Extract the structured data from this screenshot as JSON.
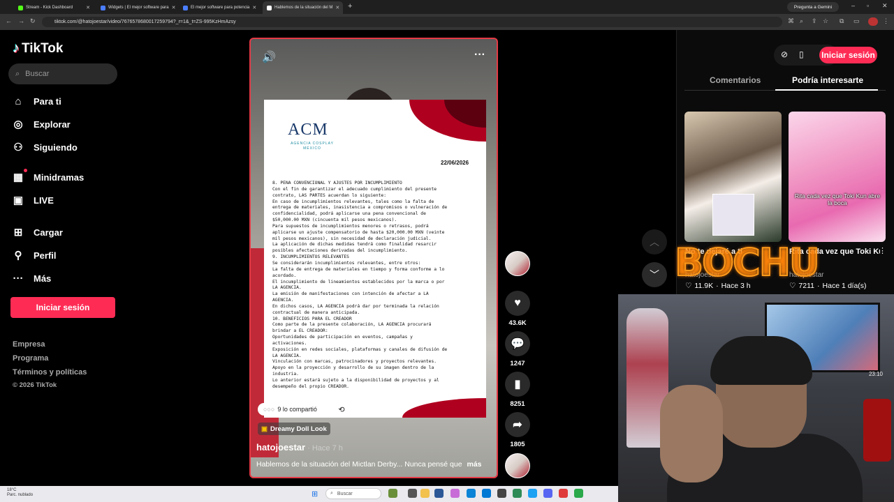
{
  "browser": {
    "tabs": [
      {
        "label": "Stream - Kick Dashboard",
        "color": "#53fc18"
      },
      {
        "label": "Widgets | El mejor software para",
        "color": "#4a7dff"
      },
      {
        "label": "El mejor software para potencia",
        "color": "#4a7dff"
      },
      {
        "label": "Hablemos de la situación del M",
        "color": "#111111"
      }
    ],
    "gemini_label": "Pregunta a Gemini",
    "url": "tiktok.com/@hatojoestar/video/7676578680017259794?_r=1&_t=ZS-995KzHmAzsy"
  },
  "sidebar": {
    "logo": "TikTok",
    "search_placeholder": "Buscar",
    "nav": [
      {
        "label": "Para ti",
        "icon": "home-icon"
      },
      {
        "label": "Explorar",
        "icon": "compass-icon"
      },
      {
        "label": "Siguiendo",
        "icon": "following-icon"
      },
      {
        "label": "Minidramas",
        "icon": "film-icon"
      },
      {
        "label": "LIVE",
        "icon": "live-icon"
      },
      {
        "label": "Cargar",
        "icon": "upload-icon"
      },
      {
        "label": "Perfil",
        "icon": "profile-icon"
      },
      {
        "label": "Más",
        "icon": "more-icon"
      }
    ],
    "login_button": "Iniciar sesión",
    "footer": [
      "Empresa",
      "Programa",
      "Términos y políticas"
    ],
    "copyright": "© 2026 TikTok"
  },
  "video": {
    "document": {
      "logo": "ACM",
      "logo_sub": "AGENCIA COSPLAY MÉXICO",
      "date": "22/06/2026",
      "lines": [
        "8. PENA CONVENCIONAL Y AJUSTES POR INCUMPLIMIENTO",
        "Con el fin de garantizar el adecuado cumplimiento del presente",
        "contrato, LAS PARTES acuerdan lo siguiente:",
        "En caso de incumplimientos relevantes, tales como la falta de",
        "entrega de materiales, inasistencia a compromisos o vulneración de",
        "confidencialidad, podrá aplicarse una pena convencional de",
        "$50,000.00 MXN (cincuenta mil pesos mexicanos).",
        "Para supuestos de incumplimientos menores o retrasos, podrá",
        "aplicarse un ajuste compensatorio de hasta $20,000.00 MXN (veinte",
        "mil pesos mexicanos), sin necesidad de declaración judicial.",
        "La aplicación de dichas medidas tendrá como finalidad resarcir",
        "posibles afectaciones derivadas del incumplimiento.",
        "9. INCUMPLIMIENTOS RELEVANTES",
        "Se considerarán incumplimientos relevantes, entre otros:",
        "La falta de entrega de materiales en tiempo y forma conforme a lo",
        "acordado.",
        "El incumplimiento de lineamientos establecidos por la marca o por",
        "LA AGENCIA.",
        "La emisión de manifestaciones con intención de afectar a LA",
        "AGENCIA.",
        "En dichos casos, LA AGENCIA podrá dar por terminada la relación",
        "contractual de manera anticipada.",
        "10. BENEFICIOS PARA EL CREADOR",
        "Como parte de la presente colaboración, LA AGENCIA procurará",
        "brindar a EL CREADOR:",
        "Oportunidades de participación en eventos, campañas y",
        "activaciones.",
        "Exposición en redes sociales, plataformas y canales de difusión de",
        "LA AGENCIA.",
        "Vinculación con marcas, patrocinadores y proyectos relevantes.",
        "Apoyo en la proyección y desarrollo de su imagen dentro de la",
        "industria.",
        "Lo anterior estará sujeto a la disponibilidad de proyectos y al",
        "desempeño del propio CREADOR."
      ]
    },
    "shared_text": "9 lo compartió",
    "effect_label": "Dreamy Doll Look",
    "author": "hatojoestar",
    "posted": " · Hace 7 h",
    "caption": "Hablemos de la situación del Mictlan Derby... Nunca pensé que",
    "more": "más",
    "likes": "43.6K",
    "comments": "1247",
    "saves": "8251",
    "shares": "1805"
  },
  "right_panel": {
    "login_button": "Iniciar sesión",
    "tabs": [
      "Comentarios",
      "Podría interesarte"
    ],
    "cards": [
      {
        "title": "No te dejaré a ti",
        "user": "hatojoestar",
        "likes": "11.9K",
        "time": "Hace 3 h"
      },
      {
        "title": "Rita cada vez que Toki Kun abre la boca JAJAJA a...",
        "user": "hatojoestar",
        "likes": "7211",
        "time": "Hace 1 día(s)",
        "overlay": "Rita cada vez que Toki Kun abre la boca"
      }
    ]
  },
  "stream": {
    "neon_text": "BOCHU",
    "clock": "23:10"
  },
  "taskbar": {
    "weather_temp": "18°C",
    "weather_desc": "Parc. nublado",
    "search_placeholder": "Buscar"
  }
}
